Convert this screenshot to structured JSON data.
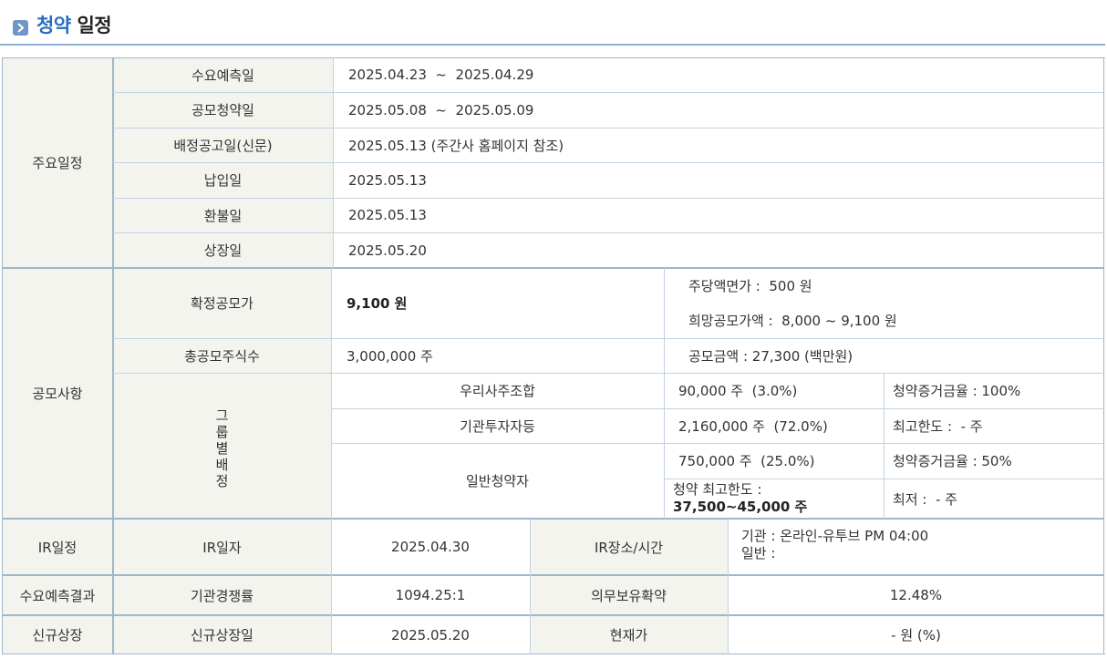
{
  "header": {
    "title_accent": "청약",
    "title_rest": "일정",
    "bullet_icon": "chevron-right-icon"
  },
  "schedule": {
    "group_label": "주요일정",
    "rows": [
      {
        "label": "수요예측일",
        "value": "2025.04.23  ~  2025.04.29"
      },
      {
        "label": "공모청약일",
        "value": "2025.05.08  ~  2025.05.09"
      },
      {
        "label": "배정공고일(신문)",
        "value": "2025.05.13 (주간사 홈페이지 참조)"
      },
      {
        "label": "납입일",
        "value": "2025.05.13"
      },
      {
        "label": "환불일",
        "value": "2025.05.13"
      },
      {
        "label": "상장일",
        "value": "2025.05.20"
      }
    ]
  },
  "offering": {
    "group_label": "공모사항",
    "final_price_label": "확정공모가",
    "final_price_value": "9,100 원",
    "par_value": "주당액면가 :  500 원",
    "desired_price": "희망공모가액 :  8,000 ~ 9,100 원",
    "total_shares_label": "총공모주식수",
    "total_shares_value": "3,000,000 주",
    "offering_amount": "공모금액 : 27,300 (백만원)",
    "group_alloc_chars": [
      "그",
      "룹",
      "별",
      "배",
      "정"
    ],
    "employee_label": "우리사주조합",
    "employee_shares": "90,000 주  (3.0%)",
    "employee_deposit": "청약증거금율 : 100%",
    "institution_label": "기관투자자등",
    "institution_shares": "2,160,000 주  (72.0%)",
    "institution_limit": "최고한도 :  - 주",
    "retail_label": "일반청약자",
    "retail_shares": "750,000 주  (25.0%)",
    "retail_deposit": "청약증거금율 : 50%",
    "retail_max_label": "청약 최고한도 :",
    "retail_max_value": "37,500~45,000 주",
    "retail_min": "최저 :  - 주"
  },
  "ir": {
    "group_label": "IR일정",
    "date_label": "IR일자",
    "date_value": "2025.04.30",
    "place_label": "IR장소/시간",
    "institution": "기관 : 온라인-유투브 PM 04:00",
    "retail": "일반 :"
  },
  "demand": {
    "group_label": "수요예측결과",
    "competition_label": "기관경쟁률",
    "competition_value": "1094.25:1",
    "lockup_label": "의무보유확약",
    "lockup_value": "12.48%"
  },
  "listing": {
    "group_label": "신규상장",
    "date_label": "신규상장일",
    "date_value": "2025.05.20",
    "price_label": "현재가",
    "price_value": "- 원 (%)"
  }
}
